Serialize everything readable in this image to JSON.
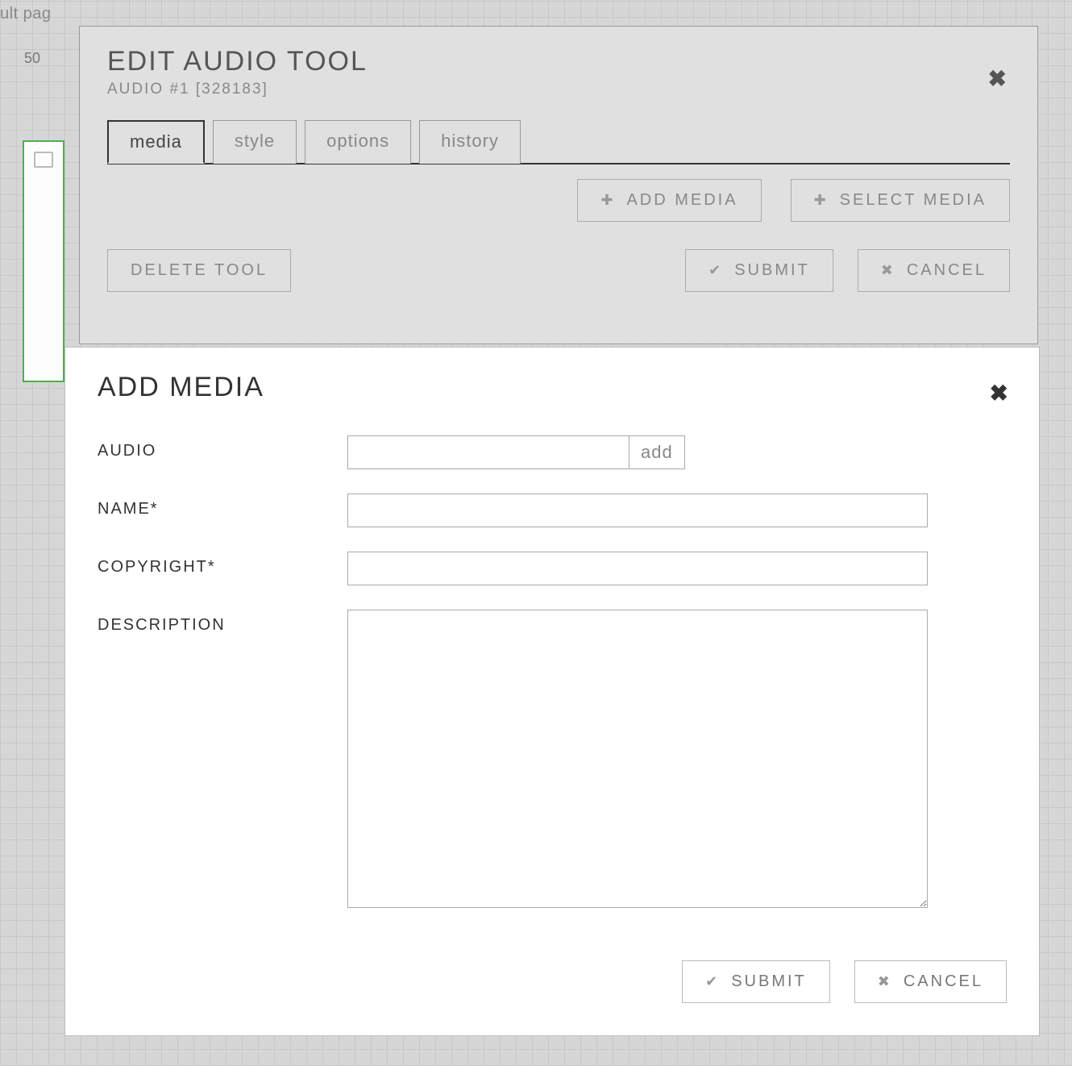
{
  "background": {
    "page_label": "ult pag",
    "ruler_tick": "50"
  },
  "edit_modal": {
    "title": "EDIT AUDIO TOOL",
    "subtitle": "AUDIO #1 [328183]",
    "tabs": {
      "media": "media",
      "style": "style",
      "options": "options",
      "history": "history"
    },
    "buttons": {
      "add_media": "ADD MEDIA",
      "select_media": "SELECT MEDIA",
      "delete_tool": "DELETE TOOL",
      "submit": "SUBMIT",
      "cancel": "CANCEL"
    }
  },
  "add_modal": {
    "title": "ADD MEDIA",
    "labels": {
      "audio": "AUDIO",
      "name": "NAME*",
      "copyright": "COPYRIGHT*",
      "description": "DESCRIPTION"
    },
    "buttons": {
      "add": "add",
      "submit": "SUBMIT",
      "cancel": "CANCEL"
    },
    "values": {
      "audio": "",
      "name": "",
      "copyright": "",
      "description": ""
    }
  }
}
